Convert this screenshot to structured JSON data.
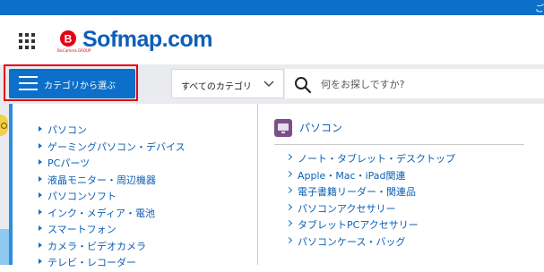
{
  "topbar": {
    "text": "ご"
  },
  "header": {
    "logo_text": "Sofmap.com",
    "logo_mark_sub": "BicCamera GROUP",
    "icons": {
      "grid": "grid-menu-icon",
      "logo": "biccamera-logo-icon"
    }
  },
  "navbar": {
    "category_button_label": "カテゴリから選ぶ",
    "scope_select_value": "すべてのカテゴリ",
    "search_placeholder": "何をお探しですか?",
    "icons": {
      "menu": "hamburger-icon",
      "dropdown": "chevron-down-icon",
      "search": "search-icon"
    }
  },
  "categories": [
    {
      "label": "パソコン"
    },
    {
      "label": "ゲーミングパソコン・デバイス"
    },
    {
      "label": "PCパーツ"
    },
    {
      "label": "液晶モニター・周辺機器"
    },
    {
      "label": "パソコンソフト"
    },
    {
      "label": "インク・メディア・電池"
    },
    {
      "label": "スマートフォン"
    },
    {
      "label": "カメラ・ビデオカメラ"
    },
    {
      "label": "テレビ・レコーダー"
    }
  ],
  "subcategory": {
    "title": "パソコン",
    "icon": "computer-icon",
    "items": [
      {
        "label": "ノート・タブレット・デスクトップ"
      },
      {
        "label": "Apple・Mac・iPad関連"
      },
      {
        "label": "電子書籍リーダー・関連品"
      },
      {
        "label": "パソコンアクセサリー"
      },
      {
        "label": "タブレットPCアクセサリー"
      },
      {
        "label": "パソコンケース・バッグ"
      }
    ]
  },
  "colors": {
    "brand_blue": "#0c6fc9",
    "logo_blue": "#0d5fb8",
    "highlight_red": "#e50012",
    "navbar_gray": "#e9ebee",
    "link_blue": "#0c5fb5",
    "pc_icon_purple": "#7c4f8a"
  }
}
